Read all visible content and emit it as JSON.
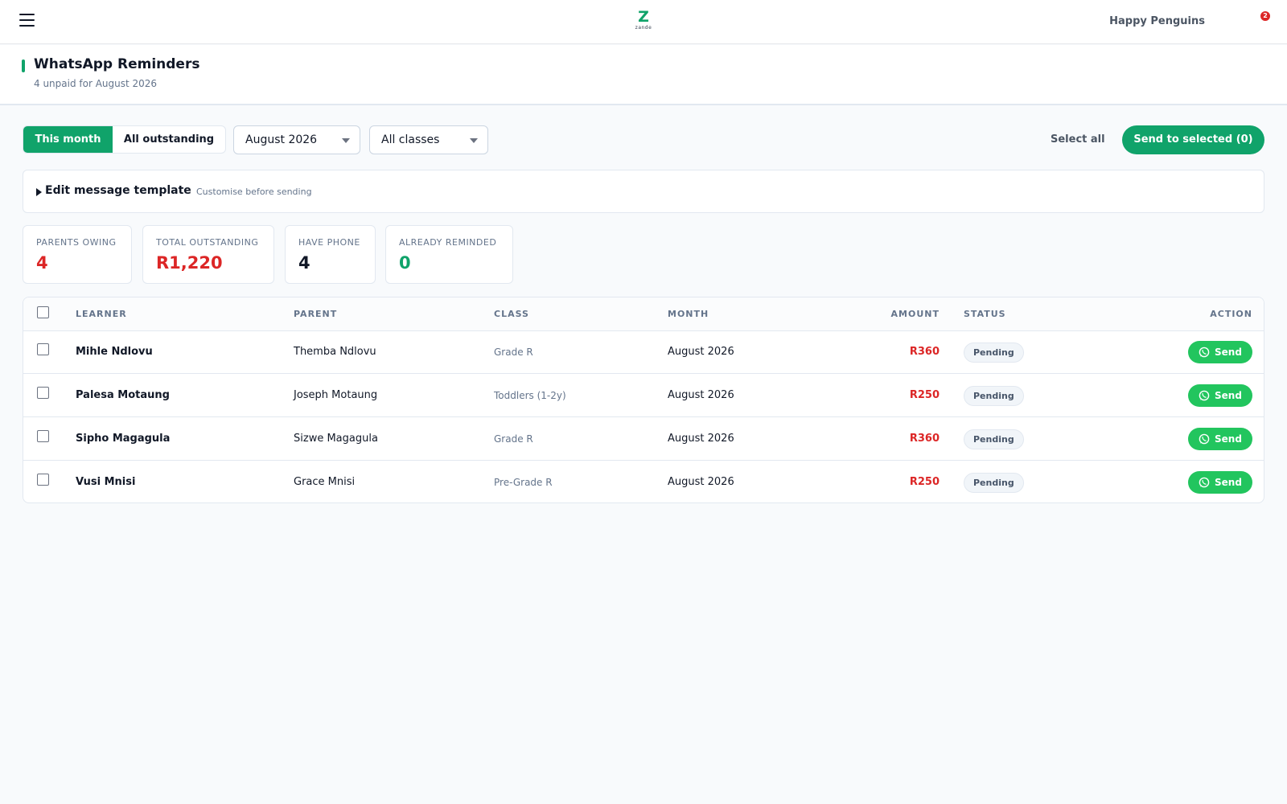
{
  "topbar": {
    "logo_mark": "Z",
    "logo_word": "zande",
    "school_name": "Happy Penguins",
    "notification_count": "2"
  },
  "header": {
    "title": "WhatsApp Reminders",
    "subtitle": "4 unpaid for August 2026"
  },
  "toolbar": {
    "tab_this_month": "This month",
    "tab_all_outstanding": "All outstanding",
    "month_select_value": "August 2026",
    "class_select_value": "All classes",
    "select_all_label": "Select all",
    "send_selected_label": "Send to selected (0)"
  },
  "template": {
    "title": "Edit message template",
    "hint": "Customise before sending"
  },
  "stats": {
    "parents_owing_label": "PARENTS OWING",
    "parents_owing_value": "4",
    "total_outstanding_label": "TOTAL OUTSTANDING",
    "total_outstanding_value": "R1,220",
    "have_phone_label": "HAVE PHONE",
    "have_phone_value": "4",
    "already_reminded_label": "ALREADY REMINDED",
    "already_reminded_value": "0"
  },
  "table": {
    "headers": {
      "learner": "LEARNER",
      "parent": "PARENT",
      "class": "CLASS",
      "month": "MONTH",
      "amount": "AMOUNT",
      "status": "STATUS",
      "action": "ACTION"
    },
    "rows": [
      {
        "learner": "Mihle Ndlovu",
        "parent": "Themba Ndlovu",
        "class": "Grade R",
        "month": "August 2026",
        "amount": "R360",
        "status": "Pending",
        "action": "Send"
      },
      {
        "learner": "Palesa Motaung",
        "parent": "Joseph Motaung",
        "class": "Toddlers (1-2y)",
        "month": "August 2026",
        "amount": "R250",
        "status": "Pending",
        "action": "Send"
      },
      {
        "learner": "Sipho Magagula",
        "parent": "Sizwe Magagula",
        "class": "Grade R",
        "month": "August 2026",
        "amount": "R360",
        "status": "Pending",
        "action": "Send"
      },
      {
        "learner": "Vusi Mnisi",
        "parent": "Grace Mnisi",
        "class": "Pre-Grade R",
        "month": "August 2026",
        "amount": "R250",
        "status": "Pending",
        "action": "Send"
      }
    ]
  },
  "colors": {
    "brand_green": "#10a36a",
    "whatsapp_green": "#22c55e",
    "owing_red": "#dc2626"
  },
  "icons": [
    "hamburger-menu-icon",
    "chevron-down-icon",
    "whatsapp-icon",
    "expand-triangle-icon"
  ]
}
